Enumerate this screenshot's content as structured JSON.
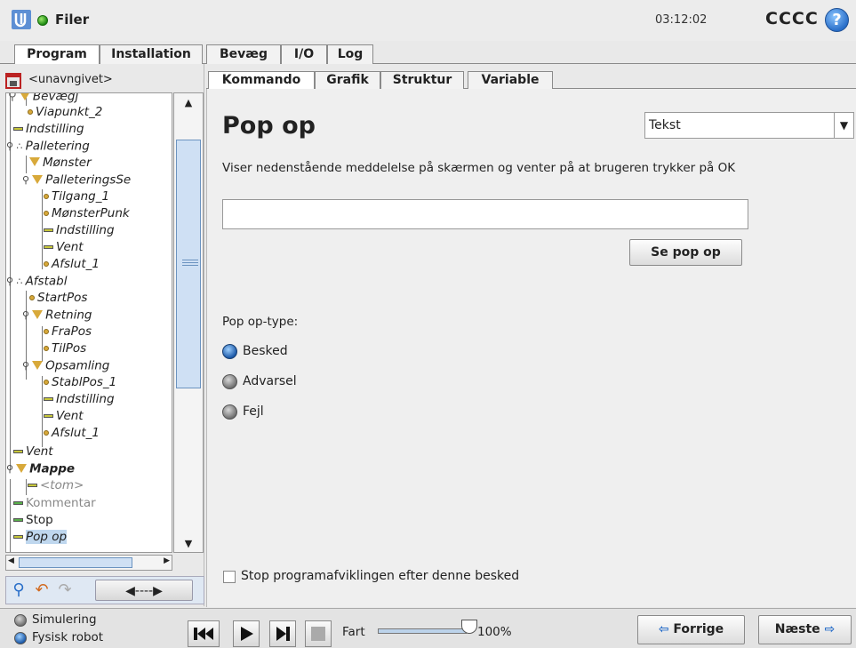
{
  "topbar": {
    "title": "Filer",
    "clock": "03:12:02",
    "robot_name": "CCCC",
    "help": "?"
  },
  "main_tabs": [
    "Program",
    "Installation",
    "Bevæg",
    "I/O",
    "Log"
  ],
  "left": {
    "program_name": "<unavngivet>",
    "tree": [
      {
        "label": "Bevægj",
        "icon": "triangle-icon"
      },
      {
        "label": "Viapunkt_2",
        "icon": "waypoint-icon"
      },
      {
        "label": "Indstilling",
        "icon": "set-icon"
      },
      {
        "label": "Palletering",
        "icon": "pallet-icon"
      },
      {
        "label": "Mønster",
        "icon": "triangle-icon"
      },
      {
        "label": "PalleteringsSe",
        "icon": "triangle-icon"
      },
      {
        "label": "Tilgang_1",
        "icon": "waypoint-icon"
      },
      {
        "label": "MønsterPunk",
        "icon": "waypoint-icon"
      },
      {
        "label": "Indstilling",
        "icon": "set-icon"
      },
      {
        "label": "Vent",
        "icon": "wait-icon"
      },
      {
        "label": "Afslut_1",
        "icon": "waypoint-icon"
      },
      {
        "label": "Afstabl",
        "icon": "pallet-icon"
      },
      {
        "label": "StartPos",
        "icon": "waypoint-icon"
      },
      {
        "label": "Retning",
        "icon": "triangle-icon"
      },
      {
        "label": "FraPos",
        "icon": "waypoint-icon"
      },
      {
        "label": "TilPos",
        "icon": "waypoint-icon"
      },
      {
        "label": "Opsamling",
        "icon": "triangle-icon"
      },
      {
        "label": "StablPos_1",
        "icon": "waypoint-icon"
      },
      {
        "label": "Indstilling",
        "icon": "set-icon"
      },
      {
        "label": "Vent",
        "icon": "wait-icon"
      },
      {
        "label": "Afslut_1",
        "icon": "waypoint-icon"
      },
      {
        "label": "Vent",
        "icon": "wait-icon"
      },
      {
        "label": "Mappe",
        "icon": "triangle-icon"
      },
      {
        "label": "<tom>",
        "icon": "set-icon"
      },
      {
        "label": "Kommentar",
        "icon": "comment-icon"
      },
      {
        "label": "Stop",
        "icon": "stop-icon"
      },
      {
        "label": "Pop op",
        "icon": "popup-icon"
      }
    ]
  },
  "sub_tabs": [
    "Kommando",
    "Grafik",
    "Struktur",
    "Variable"
  ],
  "content": {
    "heading": "Pop op",
    "type_select": "Tekst",
    "description": "Viser nedenstående meddelelse på skærmen og venter på at brugeren trykker på OK",
    "message_value": "",
    "preview_button": "Se pop op",
    "poptype_label": "Pop op-type:",
    "poptypes": [
      "Besked",
      "Advarsel",
      "Fejl"
    ],
    "selected_poptype": "Besked",
    "stop_checkbox_label": "Stop programafviklingen efter denne besked",
    "stop_checked": false
  },
  "bottom": {
    "modes": [
      "Simulering",
      "Fysisk robot"
    ],
    "active_mode": "Fysisk robot",
    "speed_label": "Fart",
    "speed_percent": "100%",
    "speed_fraction": 1.0,
    "prev_button": "Forrige",
    "next_button": "Næste"
  }
}
